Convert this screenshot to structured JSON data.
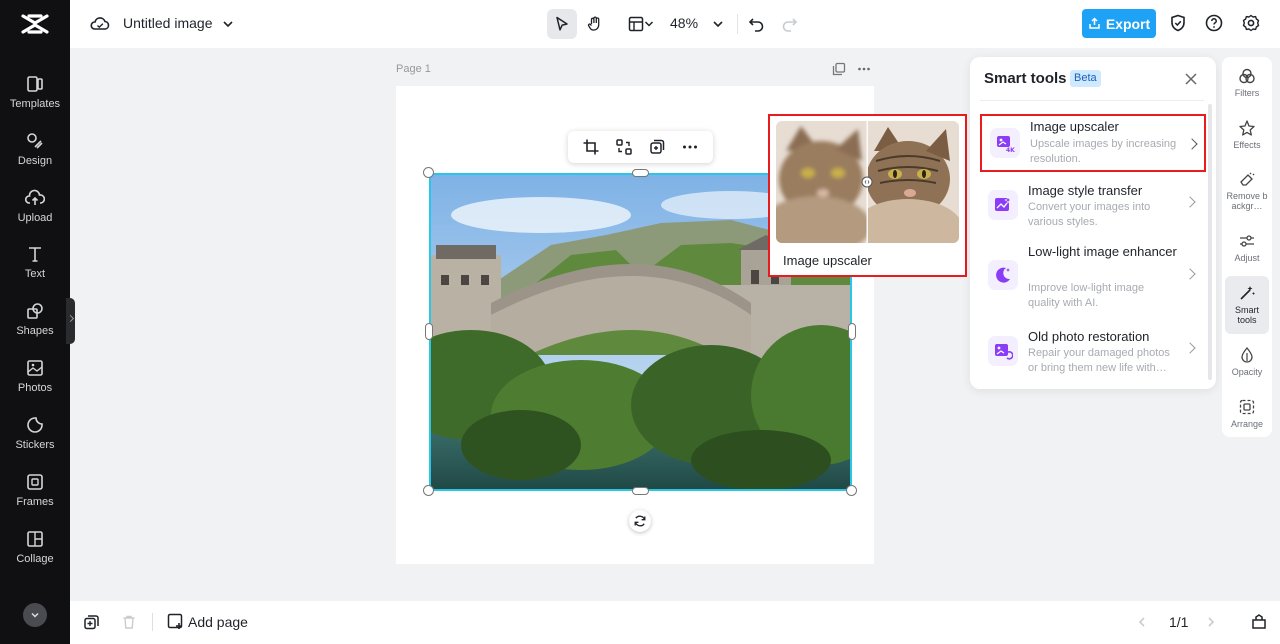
{
  "app": {
    "rail": [
      {
        "label": "Templates",
        "icon": "templates-icon"
      },
      {
        "label": "Design",
        "icon": "design-icon"
      },
      {
        "label": "Upload",
        "icon": "upload-icon"
      },
      {
        "label": "Text",
        "icon": "text-icon"
      },
      {
        "label": "Shapes",
        "icon": "shapes-icon"
      },
      {
        "label": "Photos",
        "icon": "photos-icon"
      },
      {
        "label": "Stickers",
        "icon": "stickers-icon"
      },
      {
        "label": "Frames",
        "icon": "frames-icon"
      },
      {
        "label": "Collage",
        "icon": "collage-icon"
      }
    ]
  },
  "header": {
    "title": "Untitled image",
    "zoom": "48%",
    "export_label": "Export"
  },
  "canvas": {
    "page_label": "Page 1"
  },
  "preview": {
    "caption": "Image upscaler"
  },
  "panel": {
    "title": "Smart tools",
    "badge": "Beta",
    "tools": [
      {
        "title": "Image upscaler",
        "desc": "Upscale images by increasing resolution."
      },
      {
        "title": "Image style transfer",
        "desc": "Convert your images into various styles."
      },
      {
        "title": "Low-light image enhancer",
        "desc": "Improve low-light image quality with AI."
      },
      {
        "title": "Old photo restoration",
        "desc": "Repair your damaged photos or bring them new life with…"
      }
    ]
  },
  "right_rail": [
    {
      "label": "Filters"
    },
    {
      "label": "Effects"
    },
    {
      "label": "Remove backgr…"
    },
    {
      "label": "Adjust"
    },
    {
      "label": "Smart tools"
    },
    {
      "label": "Opacity"
    },
    {
      "label": "Arrange"
    }
  ],
  "footer": {
    "add_page": "Add page",
    "pager": "1/1"
  },
  "colors": {
    "accent": "#1ea2f5",
    "highlight": "#e81c1c",
    "selection": "#29c6e6"
  }
}
